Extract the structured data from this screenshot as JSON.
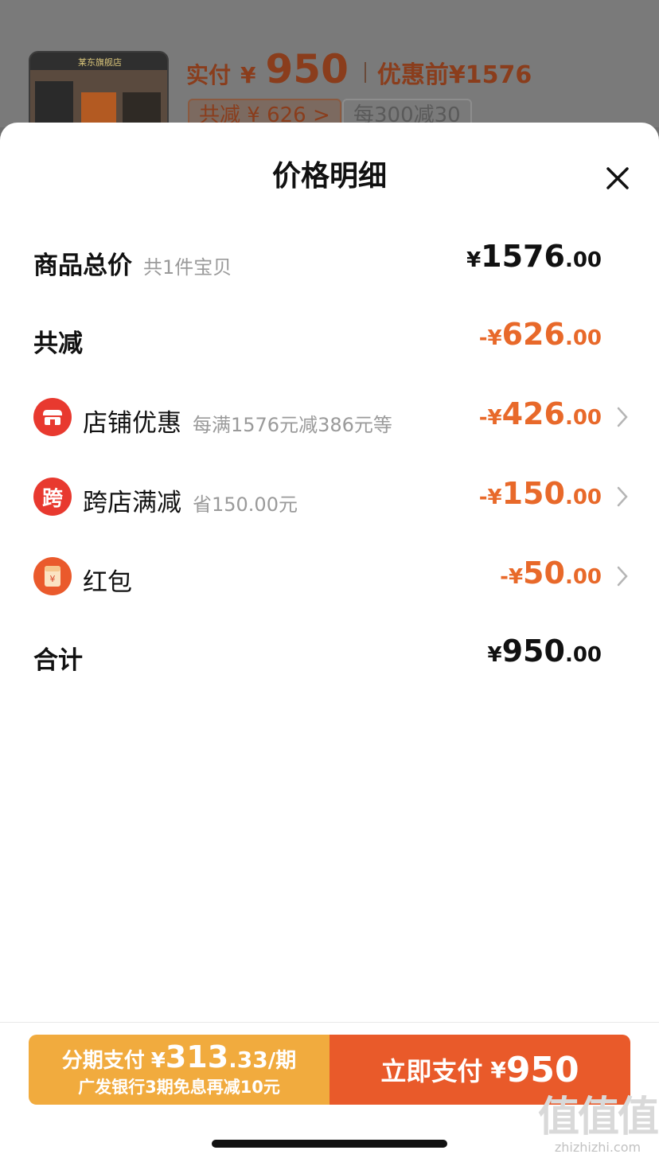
{
  "background": {
    "thumb_text": "某东旗舰店",
    "paid_label": "实付",
    "paid_currency": "¥",
    "paid_amount": "950",
    "before_label": "优惠前",
    "before_amount": "¥1576",
    "tag_total_off": "共减 ¥ 626 >",
    "tag_promo": "每300减30"
  },
  "sheet": {
    "title": "价格明细",
    "close_icon": "close-icon"
  },
  "rows": {
    "total": {
      "label": "商品总价",
      "sub": "共1件宝贝",
      "cur": "¥",
      "int": "1576",
      "dec": ".00"
    },
    "discount": {
      "label": "共减",
      "cur": "-¥",
      "int": "626",
      "dec": ".00"
    },
    "store": {
      "icon": "store-icon",
      "label": "店铺优惠",
      "sub": "每满1576元减386元等",
      "cur": "-¥",
      "int": "426",
      "dec": ".00"
    },
    "cross": {
      "icon_char": "跨",
      "label": "跨店满减",
      "sub": "省150.00元",
      "cur": "-¥",
      "int": "150",
      "dec": ".00"
    },
    "redpacket": {
      "icon": "red-packet-icon",
      "label": "红包",
      "cur": "-¥",
      "int": "50",
      "dec": ".00"
    },
    "sum": {
      "label": "合计",
      "cur": "¥",
      "int": "950",
      "dec": ".00"
    }
  },
  "footer": {
    "installment": {
      "label": "分期支付",
      "cur": "¥",
      "int": "313",
      "dec": ".33",
      "per": "/期",
      "note": "广发银行3期免息再减10元"
    },
    "pay_now": {
      "label": "立即支付",
      "cur": "¥",
      "amount": "950"
    }
  },
  "watermark": {
    "big": "值值值",
    "small": "zhizhizhi.com"
  },
  "colors": {
    "accent_orange": "#e8692a",
    "pay_now_bg": "#e95a2a",
    "installment_bg": "#f1ab3e",
    "icon_red": "#e8392f"
  }
}
